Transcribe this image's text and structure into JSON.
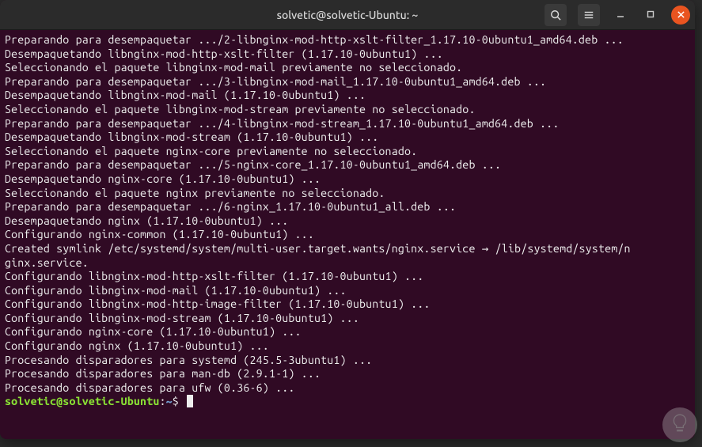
{
  "titlebar": {
    "title": "solvetic@solvetic-Ubuntu: ~"
  },
  "prompt": {
    "user_host": "solvetic@solvetic-Ubuntu",
    "colon": ":",
    "path": "~",
    "dollar": "$"
  },
  "terminal": {
    "lines": [
      "Preparando para desempaquetar .../2-libnginx-mod-http-xslt-filter_1.17.10-0ubuntu1_amd64.deb ...",
      "Desempaquetando libnginx-mod-http-xslt-filter (1.17.10-0ubuntu1) ...",
      "Seleccionando el paquete libnginx-mod-mail previamente no seleccionado.",
      "Preparando para desempaquetar .../3-libnginx-mod-mail_1.17.10-0ubuntu1_amd64.deb ...",
      "Desempaquetando libnginx-mod-mail (1.17.10-0ubuntu1) ...",
      "Seleccionando el paquete libnginx-mod-stream previamente no seleccionado.",
      "Preparando para desempaquetar .../4-libnginx-mod-stream_1.17.10-0ubuntu1_amd64.deb ...",
      "Desempaquetando libnginx-mod-stream (1.17.10-0ubuntu1) ...",
      "Seleccionando el paquete nginx-core previamente no seleccionado.",
      "Preparando para desempaquetar .../5-nginx-core_1.17.10-0ubuntu1_amd64.deb ...",
      "Desempaquetando nginx-core (1.17.10-0ubuntu1) ...",
      "Seleccionando el paquete nginx previamente no seleccionado.",
      "Preparando para desempaquetar .../6-nginx_1.17.10-0ubuntu1_all.deb ...",
      "Desempaquetando nginx (1.17.10-0ubuntu1) ...",
      "Configurando nginx-common (1.17.10-0ubuntu1) ...",
      "Created symlink /etc/systemd/system/multi-user.target.wants/nginx.service → /lib/systemd/system/n",
      "ginx.service.",
      "Configurando libnginx-mod-http-xslt-filter (1.17.10-0ubuntu1) ...",
      "Configurando libnginx-mod-mail (1.17.10-0ubuntu1) ...",
      "Configurando libnginx-mod-http-image-filter (1.17.10-0ubuntu1) ...",
      "Configurando libnginx-mod-stream (1.17.10-0ubuntu1) ...",
      "Configurando nginx-core (1.17.10-0ubuntu1) ...",
      "Configurando nginx (1.17.10-0ubuntu1) ...",
      "Procesando disparadores para systemd (245.5-3ubuntu1) ...",
      "Procesando disparadores para man-db (2.9.1-1) ...",
      "Procesando disparadores para ufw (0.36-6) ..."
    ]
  }
}
